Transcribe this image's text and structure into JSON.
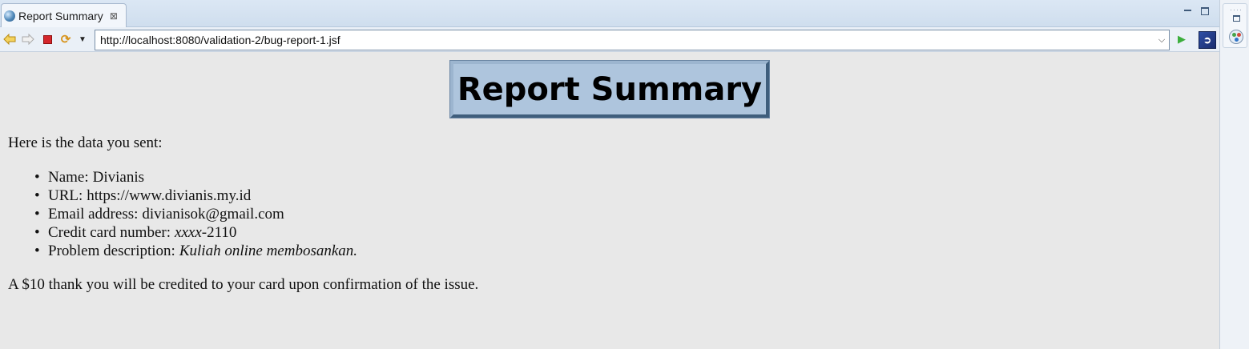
{
  "tab": {
    "title": "Report Summary",
    "close_glyph": "⊠",
    "icon": "globe-icon"
  },
  "toolbar": {
    "url": "http://localhost:8080/validation-2/bug-report-1.jsf",
    "icons": [
      "back-icon",
      "forward-icon",
      "stop-icon",
      "refresh-icon",
      "history-dropdown-icon",
      "go-icon",
      "eclipse-browser-icon"
    ]
  },
  "page": {
    "heading": "Report Summary",
    "intro": "Here is the data you sent:",
    "items": [
      {
        "label": "Name:",
        "value": "Divianis",
        "value_suffix": ""
      },
      {
        "label": "URL:",
        "value": "https://www.divianis.my.id",
        "value_suffix": ""
      },
      {
        "label": "Email address:",
        "value": "divianisok@gmail.com",
        "value_suffix": ""
      },
      {
        "label": "Credit card number:",
        "value_italic": "xxxx",
        "value_suffix": "-2110"
      },
      {
        "label": "Problem description:",
        "value_italic": "Kuliah online membosankan."
      }
    ],
    "footer": "A $10 thank you will be credited to your card upon confirmation of the issue."
  },
  "colors": {
    "heading_bg": "#aec5dd",
    "heading_border_dark": "#3f5e7c",
    "page_bg": "#e8e8e8",
    "tabbar_bg": "#d6e3f1"
  }
}
